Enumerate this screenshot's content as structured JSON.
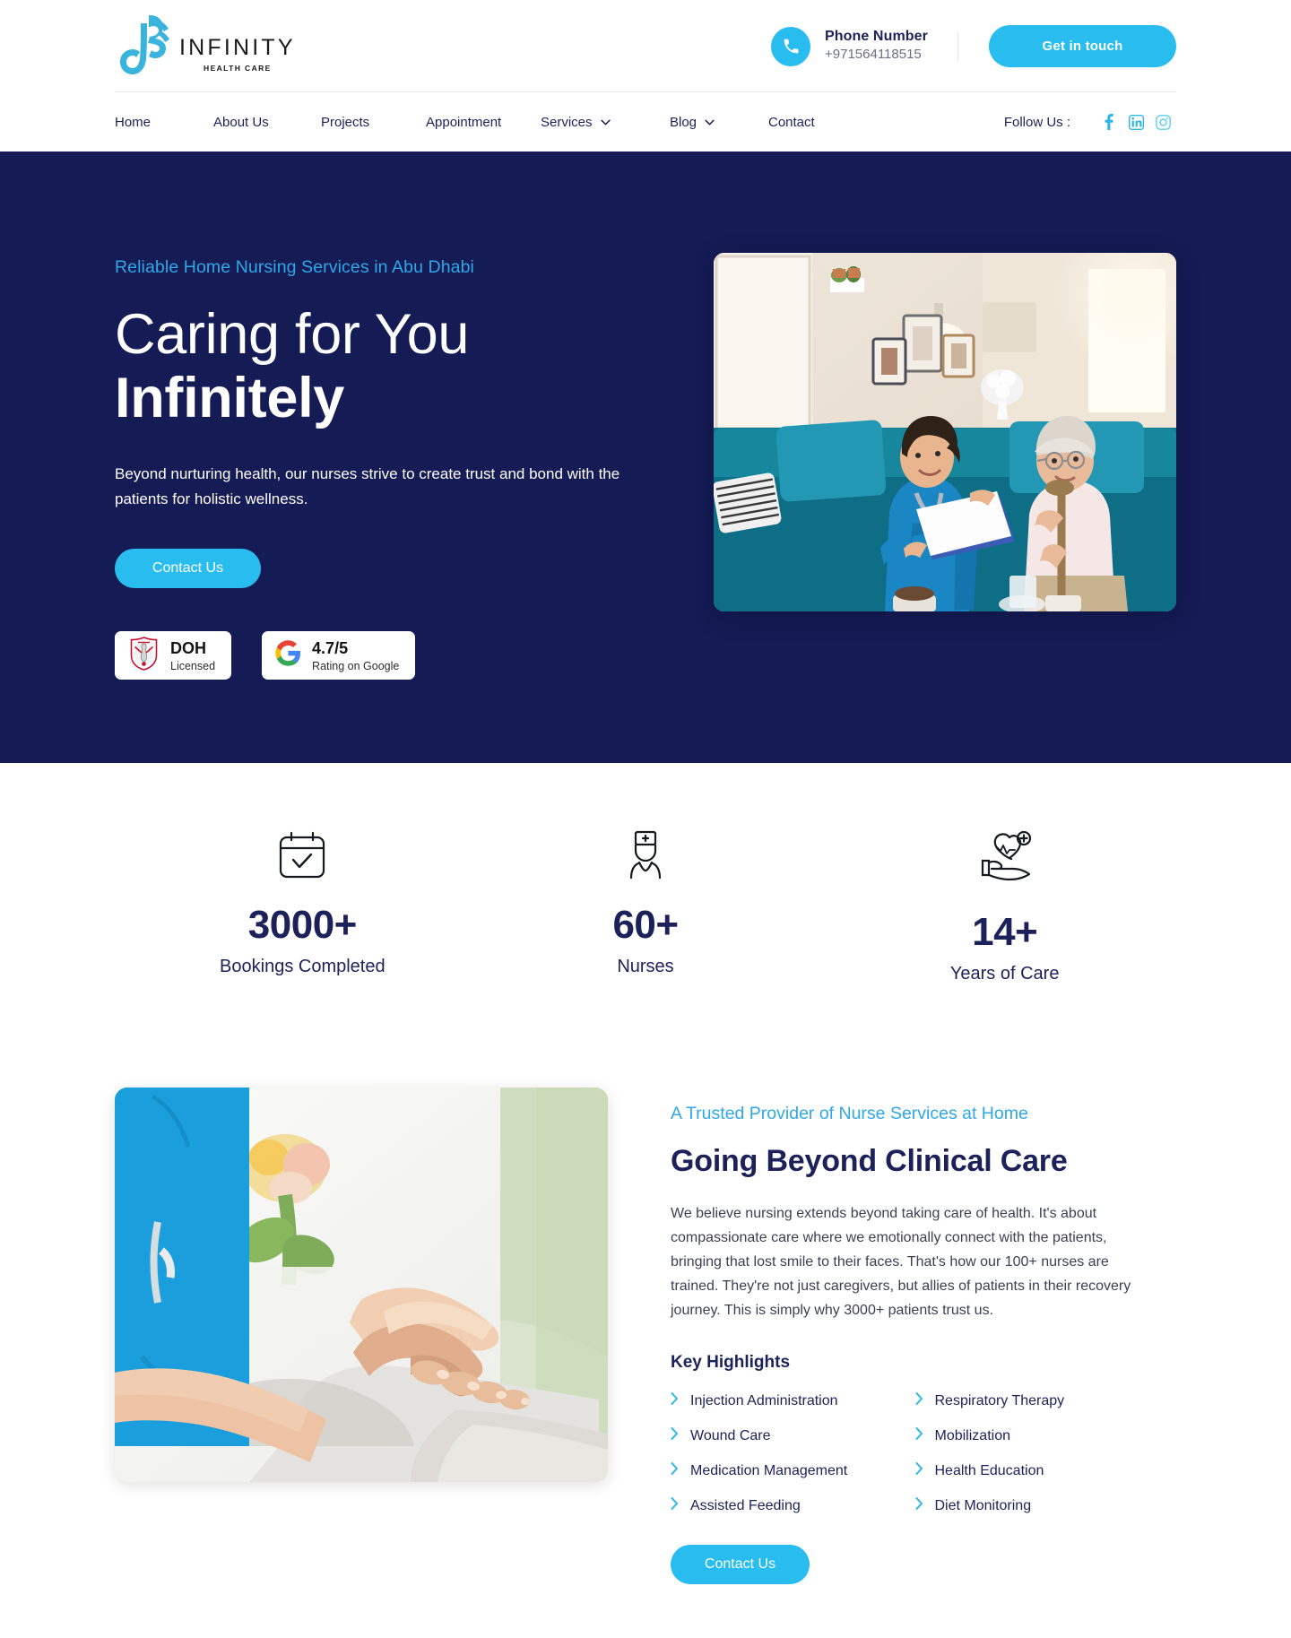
{
  "brand": {
    "name": "INFINITY",
    "tagline": "HEALTH CARE",
    "logo_icon": "infinity-dna-logo-icon",
    "accent_color": "#29bdef",
    "navy_color": "#141b55"
  },
  "header": {
    "phone_icon": "phone-icon",
    "phone_label": "Phone Number",
    "phone_number": "+971564118515",
    "cta_label": "Get in touch"
  },
  "nav": {
    "items": [
      {
        "label": "Home",
        "has_dropdown": false,
        "icon": ""
      },
      {
        "label": "About Us",
        "has_dropdown": false,
        "icon": ""
      },
      {
        "label": "Projects",
        "has_dropdown": false,
        "icon": ""
      },
      {
        "label": "Appointment",
        "has_dropdown": false,
        "icon": ""
      },
      {
        "label": "Services",
        "has_dropdown": true,
        "icon": "chevron-down-icon"
      },
      {
        "label": "Blog",
        "has_dropdown": true,
        "icon": "chevron-down-icon"
      },
      {
        "label": "Contact",
        "has_dropdown": false,
        "icon": ""
      }
    ],
    "follow_label": "Follow Us :",
    "social": [
      {
        "name": "facebook-icon"
      },
      {
        "name": "linkedin-icon"
      },
      {
        "name": "instagram-icon"
      }
    ]
  },
  "hero": {
    "eyebrow": "Reliable Home Nursing Services in Abu Dhabi",
    "heading_line1": "Caring for You",
    "heading_line2": "Infinitely",
    "paragraph": "Beyond nurturing health, our nurses strive to create trust and bond with the patients for holistic wellness.",
    "cta_label": "Contact Us",
    "image_alt": "nurse-with-elderly-patient-on-sofa-photo",
    "badges": [
      {
        "icon": "doh-emblem-icon",
        "title": "DOH",
        "sub": "Licensed"
      },
      {
        "icon": "google-g-icon",
        "title": "4.7/5",
        "sub": "Rating on Google"
      }
    ]
  },
  "stats": [
    {
      "icon": "calendar-check-icon",
      "value": "3000+",
      "label": "Bookings Completed"
    },
    {
      "icon": "nurse-avatar-icon",
      "value": "60+",
      "label": "Nurses"
    },
    {
      "icon": "heart-in-hand-icon",
      "value": "14+",
      "label": "Years of Care"
    }
  ],
  "care": {
    "image_alt": "nurse-holding-patient-hands-photo",
    "eyebrow": "A Trusted Provider of Nurse Services at Home",
    "heading": "Going Beyond Clinical Care",
    "paragraph": "We believe nursing extends beyond taking care of health. It's about compassionate care where we emotionally connect with the patients, bringing that lost smile to their faces. That's how our 100+ nurses are trained. They're not just caregivers, but allies of patients in their recovery journey. This is simply why 3000+ patients trust us.",
    "highlights_title": "Key Highlights",
    "highlights": [
      "Injection Administration",
      "Respiratory Therapy",
      "Wound Care",
      "Mobilization",
      "Medication Management",
      "Health Education",
      "Assisted Feeding",
      "Diet Monitoring"
    ],
    "cta_label": "Contact Us"
  }
}
